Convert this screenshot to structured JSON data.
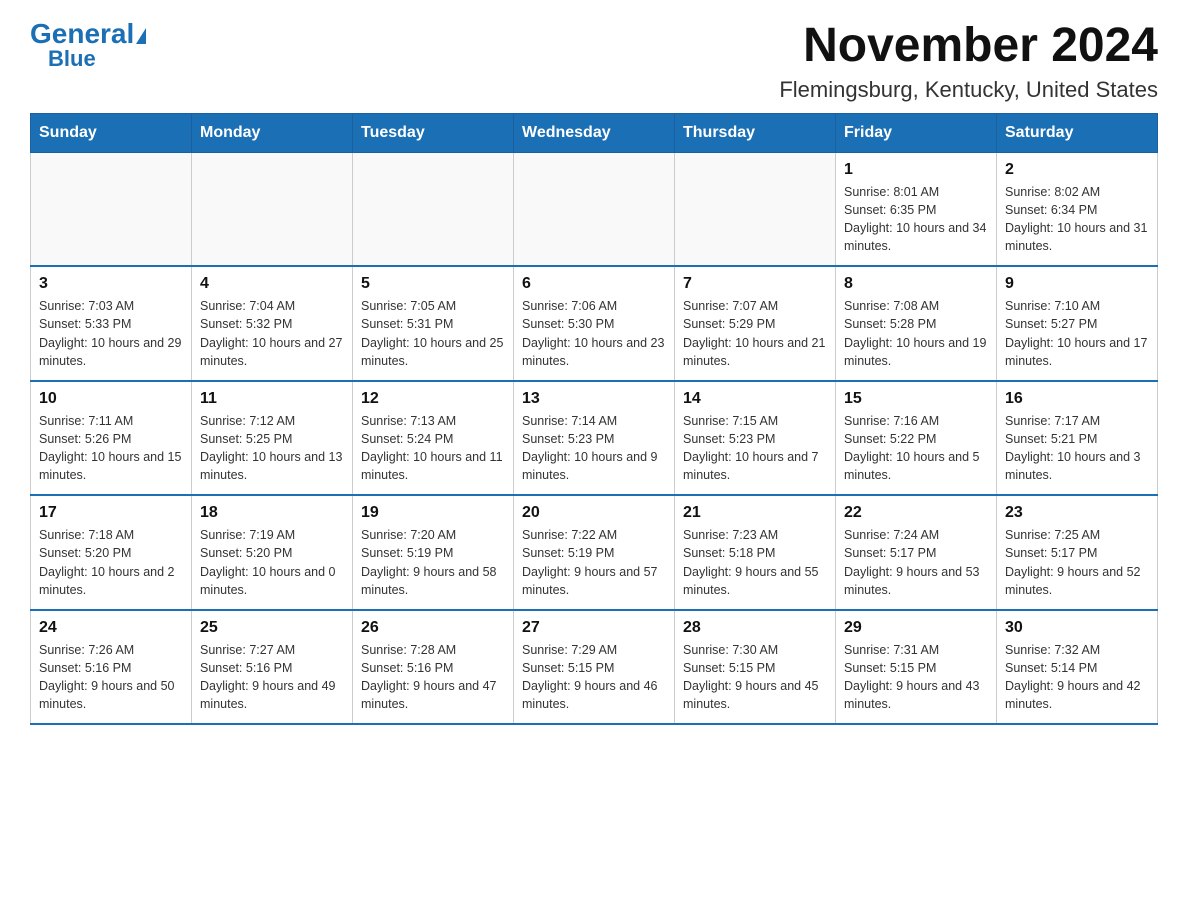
{
  "logo": {
    "general": "General",
    "blue": "Blue"
  },
  "title": "November 2024",
  "subtitle": "Flemingsburg, Kentucky, United States",
  "days_of_week": [
    "Sunday",
    "Monday",
    "Tuesday",
    "Wednesday",
    "Thursday",
    "Friday",
    "Saturday"
  ],
  "weeks": [
    [
      {
        "day": "",
        "info": ""
      },
      {
        "day": "",
        "info": ""
      },
      {
        "day": "",
        "info": ""
      },
      {
        "day": "",
        "info": ""
      },
      {
        "day": "",
        "info": ""
      },
      {
        "day": "1",
        "info": "Sunrise: 8:01 AM\nSunset: 6:35 PM\nDaylight: 10 hours and 34 minutes."
      },
      {
        "day": "2",
        "info": "Sunrise: 8:02 AM\nSunset: 6:34 PM\nDaylight: 10 hours and 31 minutes."
      }
    ],
    [
      {
        "day": "3",
        "info": "Sunrise: 7:03 AM\nSunset: 5:33 PM\nDaylight: 10 hours and 29 minutes."
      },
      {
        "day": "4",
        "info": "Sunrise: 7:04 AM\nSunset: 5:32 PM\nDaylight: 10 hours and 27 minutes."
      },
      {
        "day": "5",
        "info": "Sunrise: 7:05 AM\nSunset: 5:31 PM\nDaylight: 10 hours and 25 minutes."
      },
      {
        "day": "6",
        "info": "Sunrise: 7:06 AM\nSunset: 5:30 PM\nDaylight: 10 hours and 23 minutes."
      },
      {
        "day": "7",
        "info": "Sunrise: 7:07 AM\nSunset: 5:29 PM\nDaylight: 10 hours and 21 minutes."
      },
      {
        "day": "8",
        "info": "Sunrise: 7:08 AM\nSunset: 5:28 PM\nDaylight: 10 hours and 19 minutes."
      },
      {
        "day": "9",
        "info": "Sunrise: 7:10 AM\nSunset: 5:27 PM\nDaylight: 10 hours and 17 minutes."
      }
    ],
    [
      {
        "day": "10",
        "info": "Sunrise: 7:11 AM\nSunset: 5:26 PM\nDaylight: 10 hours and 15 minutes."
      },
      {
        "day": "11",
        "info": "Sunrise: 7:12 AM\nSunset: 5:25 PM\nDaylight: 10 hours and 13 minutes."
      },
      {
        "day": "12",
        "info": "Sunrise: 7:13 AM\nSunset: 5:24 PM\nDaylight: 10 hours and 11 minutes."
      },
      {
        "day": "13",
        "info": "Sunrise: 7:14 AM\nSunset: 5:23 PM\nDaylight: 10 hours and 9 minutes."
      },
      {
        "day": "14",
        "info": "Sunrise: 7:15 AM\nSunset: 5:23 PM\nDaylight: 10 hours and 7 minutes."
      },
      {
        "day": "15",
        "info": "Sunrise: 7:16 AM\nSunset: 5:22 PM\nDaylight: 10 hours and 5 minutes."
      },
      {
        "day": "16",
        "info": "Sunrise: 7:17 AM\nSunset: 5:21 PM\nDaylight: 10 hours and 3 minutes."
      }
    ],
    [
      {
        "day": "17",
        "info": "Sunrise: 7:18 AM\nSunset: 5:20 PM\nDaylight: 10 hours and 2 minutes."
      },
      {
        "day": "18",
        "info": "Sunrise: 7:19 AM\nSunset: 5:20 PM\nDaylight: 10 hours and 0 minutes."
      },
      {
        "day": "19",
        "info": "Sunrise: 7:20 AM\nSunset: 5:19 PM\nDaylight: 9 hours and 58 minutes."
      },
      {
        "day": "20",
        "info": "Sunrise: 7:22 AM\nSunset: 5:19 PM\nDaylight: 9 hours and 57 minutes."
      },
      {
        "day": "21",
        "info": "Sunrise: 7:23 AM\nSunset: 5:18 PM\nDaylight: 9 hours and 55 minutes."
      },
      {
        "day": "22",
        "info": "Sunrise: 7:24 AM\nSunset: 5:17 PM\nDaylight: 9 hours and 53 minutes."
      },
      {
        "day": "23",
        "info": "Sunrise: 7:25 AM\nSunset: 5:17 PM\nDaylight: 9 hours and 52 minutes."
      }
    ],
    [
      {
        "day": "24",
        "info": "Sunrise: 7:26 AM\nSunset: 5:16 PM\nDaylight: 9 hours and 50 minutes."
      },
      {
        "day": "25",
        "info": "Sunrise: 7:27 AM\nSunset: 5:16 PM\nDaylight: 9 hours and 49 minutes."
      },
      {
        "day": "26",
        "info": "Sunrise: 7:28 AM\nSunset: 5:16 PM\nDaylight: 9 hours and 47 minutes."
      },
      {
        "day": "27",
        "info": "Sunrise: 7:29 AM\nSunset: 5:15 PM\nDaylight: 9 hours and 46 minutes."
      },
      {
        "day": "28",
        "info": "Sunrise: 7:30 AM\nSunset: 5:15 PM\nDaylight: 9 hours and 45 minutes."
      },
      {
        "day": "29",
        "info": "Sunrise: 7:31 AM\nSunset: 5:15 PM\nDaylight: 9 hours and 43 minutes."
      },
      {
        "day": "30",
        "info": "Sunrise: 7:32 AM\nSunset: 5:14 PM\nDaylight: 9 hours and 42 minutes."
      }
    ]
  ]
}
